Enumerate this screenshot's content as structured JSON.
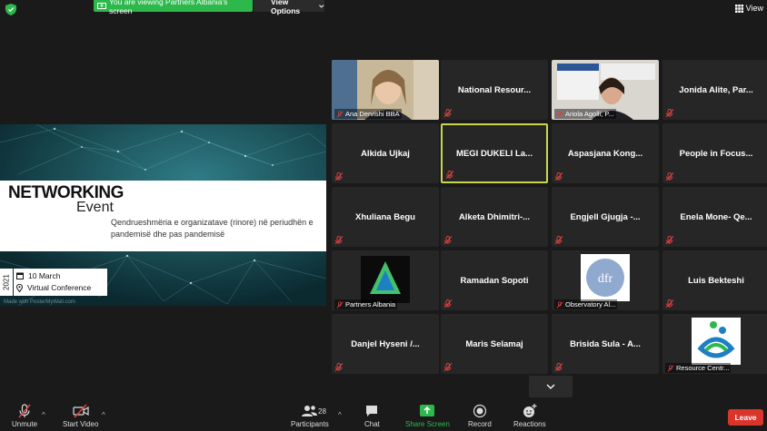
{
  "topbar": {
    "viewing_text": "You are viewing Partners Albania's screen",
    "view_options": "View Options",
    "view": "View"
  },
  "share": {
    "title": "NETWORKING",
    "subtitle": "Event",
    "description": "Qendrueshmëria e organizatave (rinore) në periudhën e pandemisë dhe pas pandemisë",
    "date": "10 March",
    "location": "Virtual Conference",
    "year": "2021",
    "watermark": "Made with PosterMyWall.com"
  },
  "tiles": [
    {
      "name": "Ana Dervishi BBA",
      "has_video": true
    },
    {
      "name": "National Resour...",
      "has_video": false
    },
    {
      "name": "Ariola Agolli, P...",
      "has_video": true
    },
    {
      "name": "Jonida Alite, Par...",
      "has_video": false
    },
    {
      "name": "Alkida Ujkaj",
      "has_video": false
    },
    {
      "name": "MEGI DUKELI La...",
      "has_video": false,
      "active": true
    },
    {
      "name": "Aspasjana Kong...",
      "has_video": false
    },
    {
      "name": "People in Focus...",
      "has_video": false
    },
    {
      "name": "Xhuliana Begu",
      "has_video": false
    },
    {
      "name": "Alketa Dhimitri-...",
      "has_video": false
    },
    {
      "name": "Engjell Gjugja -...",
      "has_video": false
    },
    {
      "name": "Enela Mone- Qe...",
      "has_video": false
    },
    {
      "name": "Partners Albania",
      "has_video": true
    },
    {
      "name": "Ramadan Sopoti",
      "has_video": false
    },
    {
      "name": "Observatory Al...",
      "has_video": true
    },
    {
      "name": "Luis Bekteshi",
      "has_video": false
    },
    {
      "name": "Danjel Hyseni /...",
      "has_video": false
    },
    {
      "name": "Maris Selamaj",
      "has_video": false
    },
    {
      "name": "Brisida Sula - A...",
      "has_video": false
    },
    {
      "name": "Resource Centr...",
      "has_video": true
    }
  ],
  "toolbar": {
    "unmute": "Unmute",
    "start_video": "Start Video",
    "participants": "Participants",
    "participants_count": "28",
    "chat": "Chat",
    "share_screen": "Share Screen",
    "record": "Record",
    "reactions": "Reactions",
    "leave": "Leave"
  },
  "colors": {
    "share_green": "#2db84b",
    "active_speaker": "#c9d84b",
    "leave_red": "#d9352b",
    "mute_red": "#e04343"
  }
}
